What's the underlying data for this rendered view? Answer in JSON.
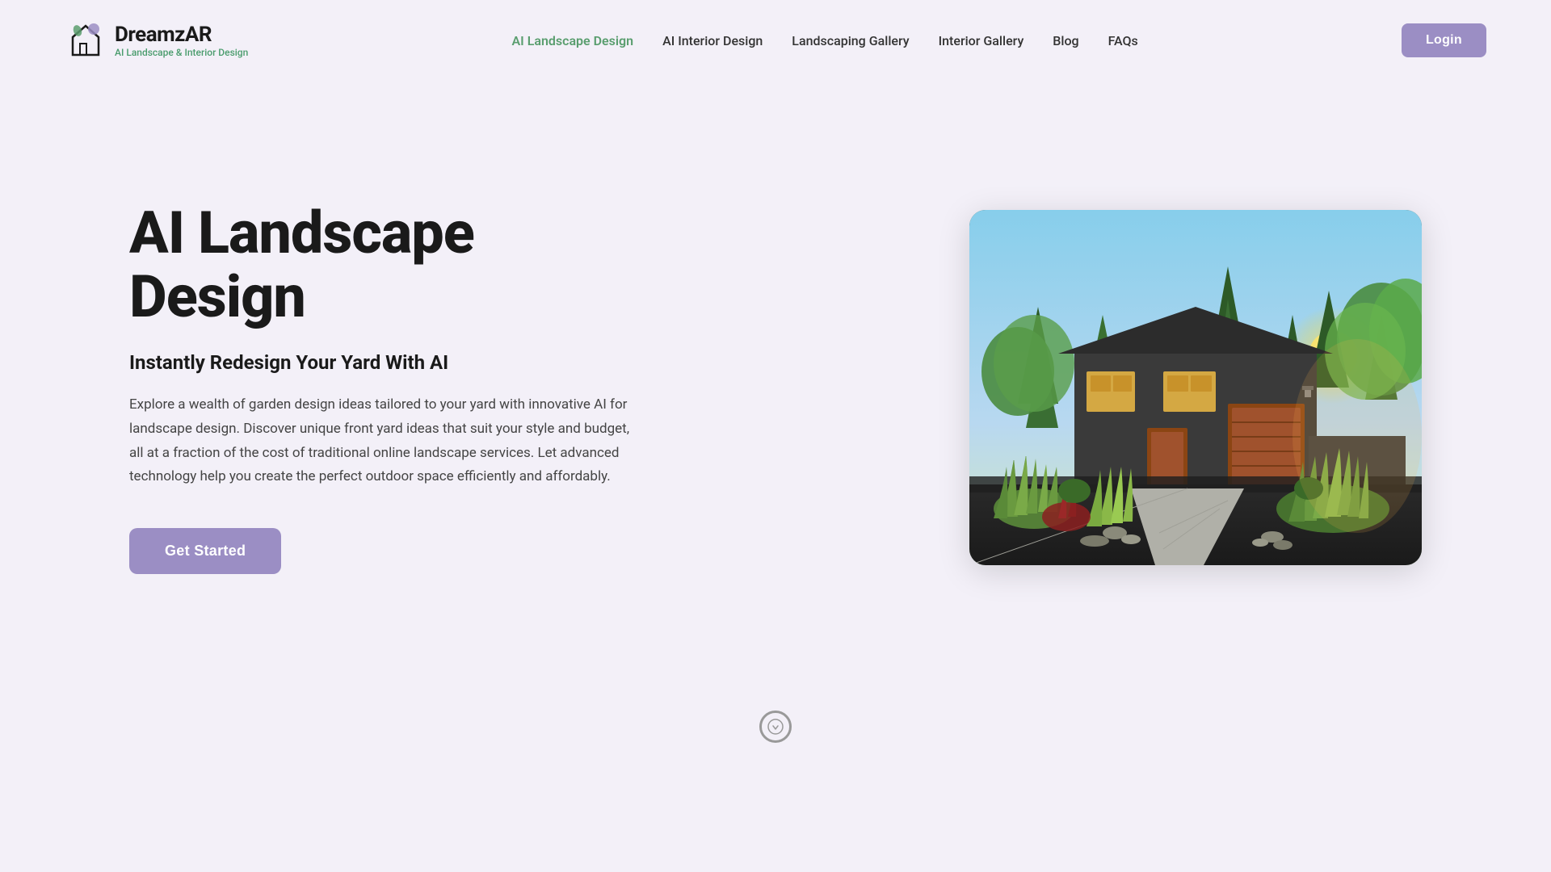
{
  "logo": {
    "name": "DreamzAR",
    "tagline": "AI Landscape & Interior Design"
  },
  "nav": {
    "links": [
      {
        "id": "ai-landscape",
        "label": "AI Landscape Design",
        "active": true
      },
      {
        "id": "ai-interior",
        "label": "AI Interior Design",
        "active": false
      },
      {
        "id": "landscaping-gallery",
        "label": "Landscaping Gallery",
        "active": false
      },
      {
        "id": "interior-gallery",
        "label": "Interior Gallery",
        "active": false
      },
      {
        "id": "blog",
        "label": "Blog",
        "active": false
      },
      {
        "id": "faqs",
        "label": "FAQs",
        "active": false
      }
    ],
    "login_label": "Login"
  },
  "hero": {
    "title": "AI Landscape Design",
    "subtitle": "Instantly Redesign Your Yard With AI",
    "description": "Explore a wealth of garden design ideas tailored to your yard with innovative AI for landscape design. Discover unique front yard ideas that suit your style and budget, all at a fraction of the cost of traditional online landscape services. Let advanced technology help you create the perfect outdoor space efficiently and affordably.",
    "cta_label": "Get Started"
  },
  "colors": {
    "accent_purple": "#9b8ec4",
    "accent_green": "#5a9e6f",
    "background": "#f3f0f8",
    "text_dark": "#1a1a1a",
    "text_mid": "#444444"
  }
}
